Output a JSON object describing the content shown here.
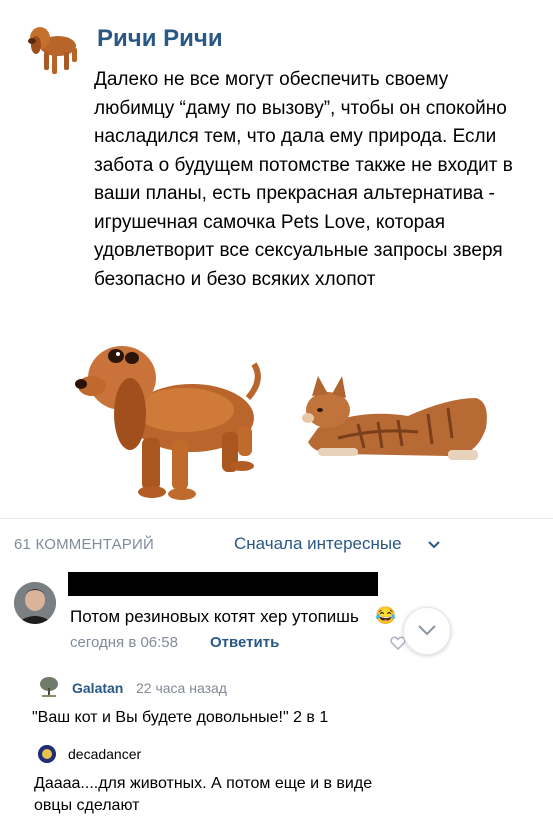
{
  "post": {
    "author": "Ричи Ричи",
    "text": "Далеко не все могут обеспечить своему любимцу “даму по вызову”, чтобы он спокойно насладился тем, что дала ему природа. Если забота о будущем потомстве также не входит в ваши планы, есть прекрасная альтернатива - игрушечная самочка Pets Love, которая удовлетворит все сексуальные запросы зверя безопасно и безо всяких хлопот"
  },
  "comments": {
    "count_label": "61 КОММЕНТАРИЙ",
    "sort_label": "Сначала интересные"
  },
  "comment1": {
    "text": "Потом резиновых котят хер утопишь",
    "emoji": "😂",
    "time": "сегодня в 06:58",
    "reply": "Ответить"
  },
  "nested": [
    {
      "name": "Galatan",
      "time": "22 часа назад",
      "text": "\"Ваш кот и Вы будете довольные!\"  2 в 1"
    },
    {
      "name": "decadancer",
      "text": "Дaaaa....для животных. А потом еще и в виде овцы сделают"
    }
  ],
  "icons": {
    "chevron": "chevron-down-icon",
    "heart": "heart-icon",
    "scroll": "scroll-down-icon"
  },
  "colors": {
    "link": "#2a5885",
    "secondary": "#818c99"
  }
}
